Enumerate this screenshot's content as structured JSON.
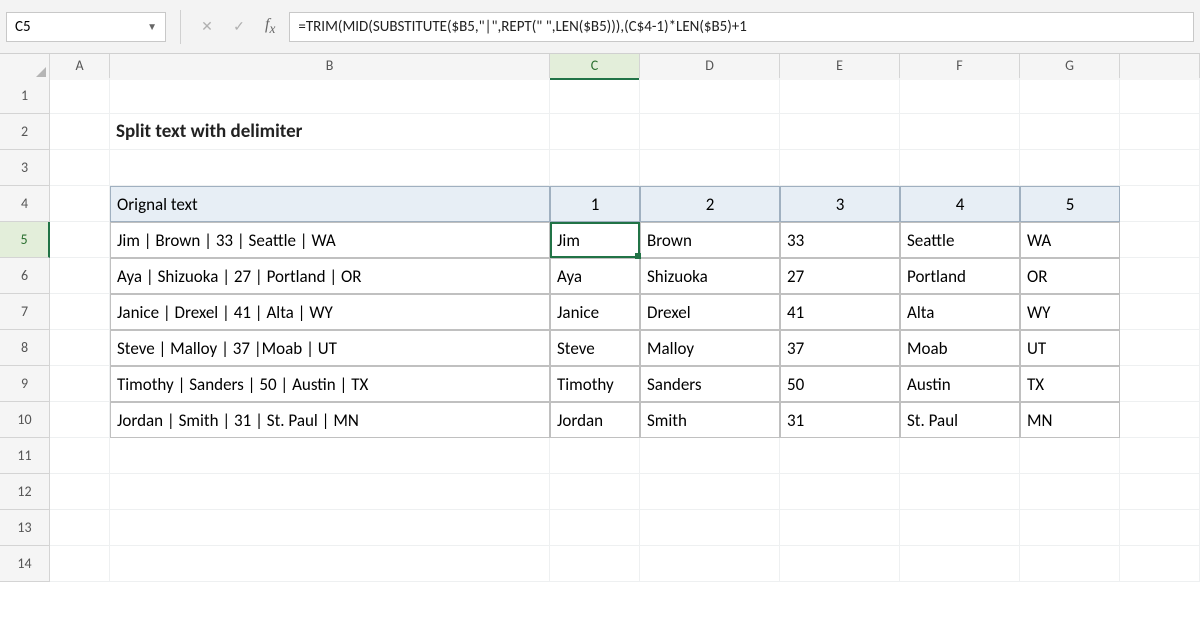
{
  "ribbon": {
    "name_box": "C5",
    "formula": "=TRIM(MID(SUBSTITUTE($B5,\"|\",REPT(\" \",LEN($B5))),(C$4-1)*LEN($B5)+1"
  },
  "active_cell": {
    "col": "C",
    "row": 5
  },
  "title": "Split text with delimiter",
  "columns": [
    "A",
    "B",
    "C",
    "D",
    "E",
    "F",
    "G",
    ""
  ],
  "row_numbers": [
    "1",
    "2",
    "3",
    "4",
    "5",
    "6",
    "7",
    "8",
    "9",
    "10",
    "11",
    "12",
    "13",
    "14"
  ],
  "table": {
    "header_b": "Orignal text",
    "header_nums": [
      "1",
      "2",
      "3",
      "4",
      "5"
    ],
    "rows": [
      {
        "b": "Jim | Brown | 33 | Seattle | WA",
        "c": "Jim",
        "d": "Brown",
        "e": "33",
        "f": "Seattle",
        "g": "WA"
      },
      {
        "b": "Aya | Shizuoka | 27 | Portland | OR",
        "c": "Aya",
        "d": "Shizuoka",
        "e": "27",
        "f": "Portland",
        "g": "OR"
      },
      {
        "b": "Janice | Drexel | 41 | Alta | WY",
        "c": "Janice",
        "d": "Drexel",
        "e": "41",
        "f": "Alta",
        "g": "WY"
      },
      {
        "b": "Steve | Malloy | 37 |Moab | UT",
        "c": "Steve",
        "d": "Malloy",
        "e": "37",
        "f": "Moab",
        "g": "UT"
      },
      {
        "b": "Timothy | Sanders | 50 | Austin | TX",
        "c": "Timothy",
        "d": "Sanders",
        "e": "50",
        "f": "Austin",
        "g": "TX"
      },
      {
        "b": "Jordan | Smith | 31 | St. Paul | MN",
        "c": "Jordan",
        "d": "Smith",
        "e": "31",
        "f": "St. Paul",
        "g": "MN"
      }
    ]
  }
}
